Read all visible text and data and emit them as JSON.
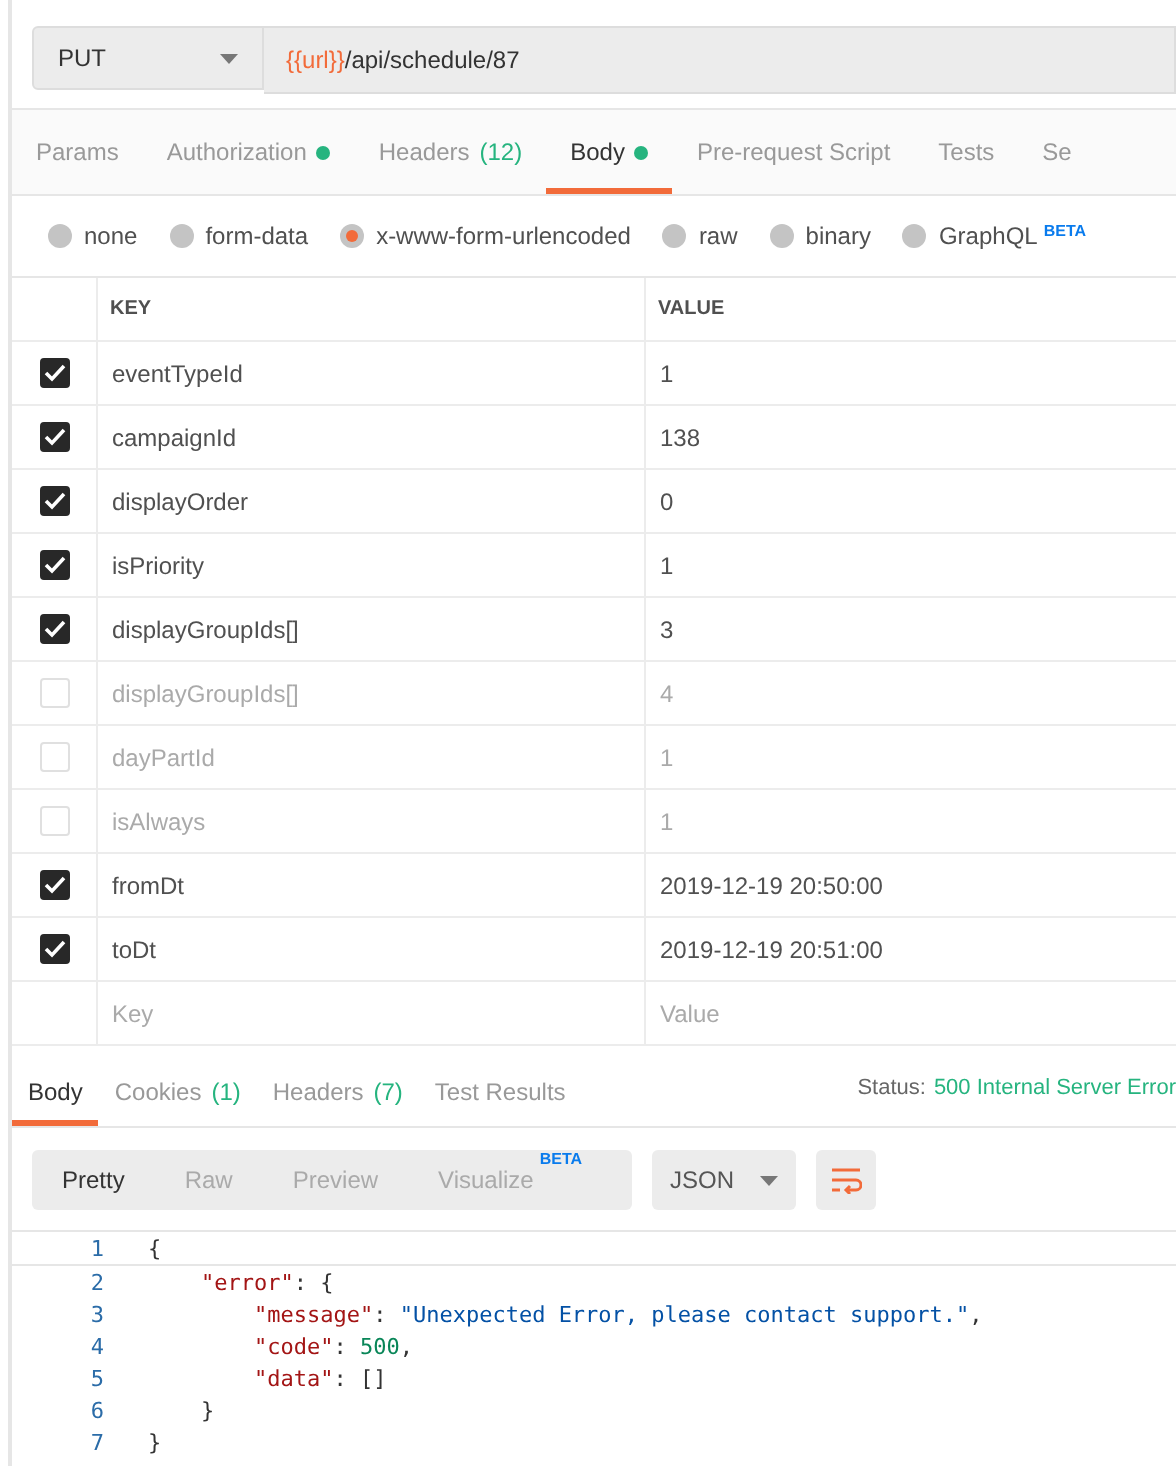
{
  "request": {
    "method": "PUT",
    "url_variable": "{{url}}",
    "url_path": "/api/schedule/87"
  },
  "request_tabs": [
    {
      "label": "Params",
      "selected": false,
      "dot": false
    },
    {
      "label": "Authorization",
      "selected": false,
      "dot": true
    },
    {
      "label": "Headers",
      "count": "(12)",
      "selected": false,
      "dot": false
    },
    {
      "label": "Body",
      "selected": true,
      "dot": true
    },
    {
      "label": "Pre-request Script",
      "selected": false,
      "dot": false
    },
    {
      "label": "Tests",
      "selected": false,
      "dot": false
    },
    {
      "label": "Se",
      "selected": false,
      "dot": false
    }
  ],
  "body_types": [
    {
      "label": "none",
      "selected": false
    },
    {
      "label": "form-data",
      "selected": false
    },
    {
      "label": "x-www-form-urlencoded",
      "selected": true
    },
    {
      "label": "raw",
      "selected": false
    },
    {
      "label": "binary",
      "selected": false
    },
    {
      "label": "GraphQL",
      "badge": "BETA",
      "selected": false
    }
  ],
  "params_table": {
    "columns": [
      "KEY",
      "VALUE"
    ],
    "rows": [
      {
        "key": "eventTypeId",
        "value": "1",
        "checked": true
      },
      {
        "key": "campaignId",
        "value": "138",
        "checked": true
      },
      {
        "key": "displayOrder",
        "value": "0",
        "checked": true
      },
      {
        "key": "isPriority",
        "value": "1",
        "checked": true
      },
      {
        "key": "displayGroupIds[]",
        "value": "3",
        "checked": true
      },
      {
        "key": "displayGroupIds[]",
        "value": "4",
        "checked": false
      },
      {
        "key": "dayPartId",
        "value": "1",
        "checked": false
      },
      {
        "key": "isAlways",
        "value": "1",
        "checked": false
      },
      {
        "key": "fromDt",
        "value": "2019-12-19 20:50:00",
        "checked": true
      },
      {
        "key": "toDt",
        "value": "2019-12-19 20:51:00",
        "checked": true
      }
    ],
    "new_row": {
      "key_placeholder": "Key",
      "value_placeholder": "Value"
    }
  },
  "response_tabs": [
    {
      "label": "Body",
      "selected": true
    },
    {
      "label": "Cookies",
      "count": "(1)",
      "selected": false
    },
    {
      "label": "Headers",
      "count": "(7)",
      "selected": false
    },
    {
      "label": "Test Results",
      "selected": false
    }
  ],
  "status": {
    "label": "Status:",
    "value": "500 Internal Server Error"
  },
  "view_modes": [
    {
      "label": "Pretty",
      "selected": true
    },
    {
      "label": "Raw",
      "selected": false
    },
    {
      "label": "Preview",
      "selected": false
    },
    {
      "label": "Visualize",
      "badge": "BETA",
      "selected": false
    }
  ],
  "format_select": "JSON",
  "code_lines": [
    {
      "number": "1",
      "tokens": [
        {
          "kind": "punct",
          "text": "{"
        }
      ]
    },
    {
      "number": "2",
      "tokens": [
        {
          "kind": "key",
          "text": "    \"error\""
        },
        {
          "kind": "punct",
          "text": ": {"
        }
      ]
    },
    {
      "number": "3",
      "tokens": [
        {
          "kind": "key",
          "text": "        \"message\""
        },
        {
          "kind": "punct",
          "text": ": "
        },
        {
          "kind": "string",
          "text": "\"Unexpected Error, please contact support.\""
        },
        {
          "kind": "punct",
          "text": ","
        }
      ]
    },
    {
      "number": "4",
      "tokens": [
        {
          "kind": "key",
          "text": "        \"code\""
        },
        {
          "kind": "punct",
          "text": ": "
        },
        {
          "kind": "number",
          "text": "500"
        },
        {
          "kind": "punct",
          "text": ","
        }
      ]
    },
    {
      "number": "5",
      "tokens": [
        {
          "kind": "key",
          "text": "        \"data\""
        },
        {
          "kind": "punct",
          "text": ": []"
        }
      ]
    },
    {
      "number": "6",
      "tokens": [
        {
          "kind": "punct",
          "text": "    }"
        }
      ]
    },
    {
      "number": "7",
      "tokens": [
        {
          "kind": "punct",
          "text": "}"
        }
      ]
    }
  ]
}
